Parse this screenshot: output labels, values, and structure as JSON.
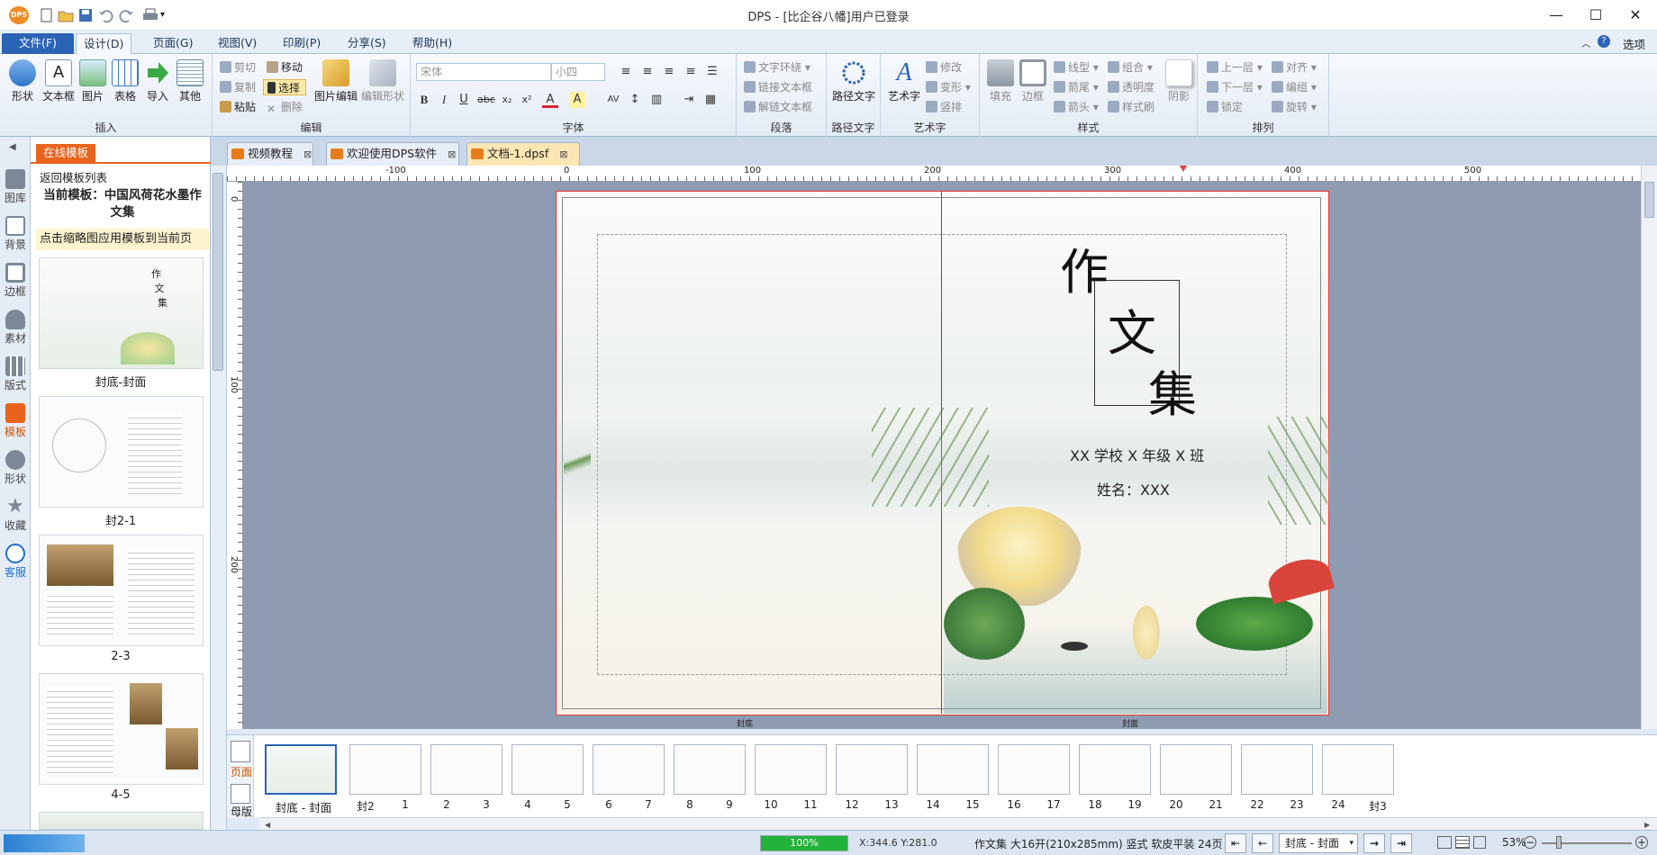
{
  "window": {
    "title": "DPS - [比企谷八幡]用户已登录",
    "app_badge": "DPS",
    "controls": [
      "minimize",
      "maximize",
      "close"
    ]
  },
  "quick_access": [
    "new",
    "open",
    "save",
    "undo",
    "redo",
    "print"
  ],
  "menu": {
    "tabs": [
      "文件(F)",
      "设计(D)",
      "页面(G)",
      "视图(V)",
      "印刷(P)",
      "分享(S)",
      "帮助(H)"
    ],
    "active": "设计(D)",
    "options_label": "选项"
  },
  "ribbon": {
    "insert": {
      "label": "插入",
      "items": [
        "形状",
        "文本框",
        "图片",
        "表格",
        "导入",
        "其他"
      ]
    },
    "edit": {
      "label": "编辑",
      "cut": "剪切",
      "copy": "复制",
      "paste": "粘贴",
      "move": "移动",
      "select": "选择",
      "delete": "删除",
      "image_edit": "图片编辑",
      "shape_edit": "编辑形状"
    },
    "font": {
      "label": "字体",
      "family": "宋体",
      "size": "小四"
    },
    "paragraph": {
      "label": "段落",
      "wrap": "文字环绕",
      "link": "链接文本框",
      "unlink": "解链文本框"
    },
    "path_text": {
      "label": "路径文字",
      "item": "路径文字"
    },
    "art_text": {
      "label": "艺术字",
      "item": "艺术字",
      "modify": "修改",
      "transform": "变形",
      "vertical": "竖排"
    },
    "style": {
      "label": "样式",
      "fill": "填充",
      "border": "边框",
      "line_type": "线型",
      "arrow": "箭尾",
      "arrow_head": "箭头",
      "group": "组合",
      "transparency": "透明度",
      "format_painter": "样式刷",
      "shadow": "阴影"
    },
    "arrange": {
      "label": "排列",
      "up": "上一层",
      "down": "下一层",
      "lock": "锁定",
      "align": "对齐",
      "edit": "编组",
      "rotate": "旋转"
    }
  },
  "leftbar": {
    "items": [
      "图库",
      "背景",
      "边框",
      "素材",
      "版式",
      "模板",
      "形状",
      "收藏",
      "客服"
    ],
    "selected": "模板"
  },
  "template_panel": {
    "tab": "在线模板",
    "back": "返回模板列表",
    "current": "当前模板：中国风荷花水墨作文集",
    "hint": "点击缩略图应用模板到当前页",
    "thumbs": [
      "封底-封面",
      "封2-1",
      "2-3",
      "4-5"
    ]
  },
  "doc_tabs": [
    {
      "label": "视频教程",
      "active": false
    },
    {
      "label": "欢迎使用DPS软件",
      "active": false
    },
    {
      "label": "文档-1.dpsf",
      "active": true
    }
  ],
  "rulers": {
    "h_ticks": [
      "-100",
      "0",
      "100",
      "200",
      "300",
      "400",
      "500"
    ],
    "v_ticks": [
      "0",
      "100",
      "200"
    ]
  },
  "page": {
    "title_chars": [
      "作",
      "文",
      "集"
    ],
    "school_line": "XX 学校 X 年级 X 班",
    "name_line": "姓名：XXX",
    "left_label": "封底",
    "right_label": "封面"
  },
  "bottom_strip": {
    "mode_tabs": [
      "页面",
      "母版"
    ],
    "page_labels": [
      "封底 - 封面",
      "封2",
      "1",
      "2",
      "3",
      "4",
      "5",
      "6",
      "7",
      "8",
      "9",
      "10",
      "11",
      "12",
      "13",
      "14",
      "15",
      "16",
      "17",
      "18",
      "19",
      "20",
      "21",
      "22",
      "23",
      "24",
      "封3"
    ]
  },
  "status": {
    "progress": "100%",
    "progress_value": 1.0,
    "coords": "X:344.6  Y:281.0",
    "doc_info": "作文集 大16开(210x285mm) 竖式 软皮平装 24页",
    "page_select": "封底 - 封面",
    "zoom": "53%"
  },
  "colors": {
    "accent": "#2b63b5",
    "selected": "#e8641d",
    "page_border": "#e53b3b",
    "progress": "#22b33a"
  }
}
